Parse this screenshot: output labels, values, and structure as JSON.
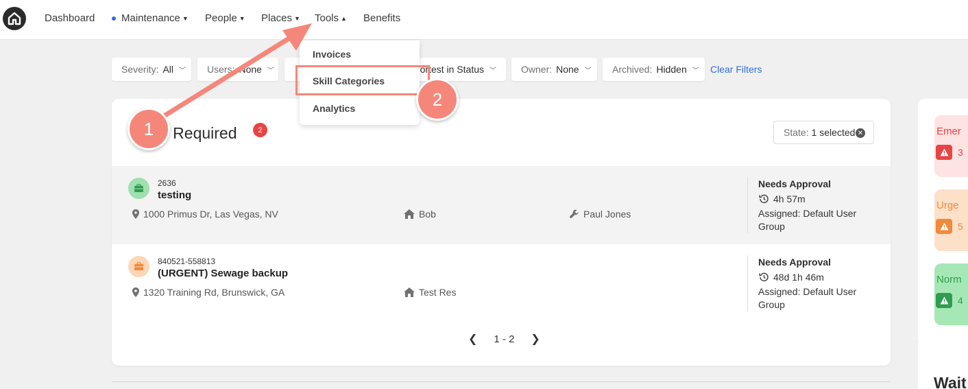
{
  "nav": {
    "items": [
      {
        "label": "Dashboard"
      },
      {
        "label": "Maintenance"
      },
      {
        "label": "People"
      },
      {
        "label": "Places"
      },
      {
        "label": "Tools"
      },
      {
        "label": "Benefits"
      }
    ],
    "tools_menu": [
      "Invoices",
      "Skill Categories",
      "Analytics"
    ]
  },
  "filters": {
    "severity": {
      "label": "Severity:",
      "value": "All"
    },
    "users": {
      "label": "Users:",
      "value": "None"
    },
    "sort": {
      "value": "ortest in Status"
    },
    "owner": {
      "label": "Owner:",
      "value": "None"
    },
    "archived": {
      "label": "Archived:",
      "value": "Hidden"
    },
    "clear": "Clear Filters"
  },
  "card": {
    "title": "n Required",
    "count": "2",
    "state_filter": {
      "label": "State:",
      "value": "1 selected"
    },
    "rows": [
      {
        "id": "2636",
        "title": "testing",
        "address": "1000 Primus Dr, Las Vegas, NV",
        "resident": "Bob",
        "technician": "Paul Jones",
        "status": "Needs Approval",
        "duration": "4h 57m",
        "assigned": "Assigned: Default User Group"
      },
      {
        "id": "840521-558813",
        "title": "(URGENT) Sewage backup",
        "address": "1320 Training Rd, Brunswick, GA",
        "resident": "Test Res",
        "technician": "",
        "status": "Needs Approval",
        "duration": "48d 1h 46m",
        "assigned": "Assigned: Default User Group"
      }
    ],
    "pagination": "1 - 2"
  },
  "side": {
    "alerts": [
      {
        "label": "Emer",
        "count": "3",
        "color": "#e84444"
      },
      {
        "label": "Urge",
        "count": "5",
        "color": "#f08a3a"
      },
      {
        "label": "Norm",
        "count": "4",
        "color": "#2e9d4f"
      }
    ],
    "wait_title": "Wait"
  },
  "annotations": {
    "step1": "1",
    "step2": "2"
  },
  "colors": {
    "accent": "#2f6fd6",
    "annotation": "#f5877a",
    "badge": "#e84444"
  }
}
